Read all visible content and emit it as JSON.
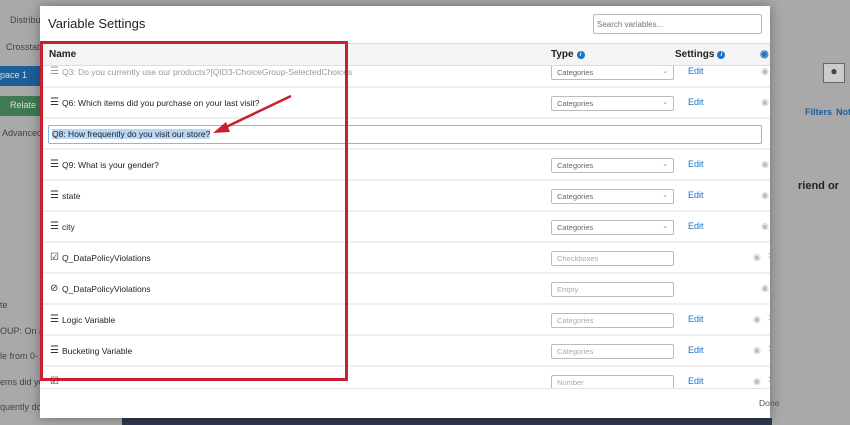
{
  "background": {
    "tab1": "Distribut",
    "tab2": "Crosstabs",
    "workspace": "pace 1",
    "relate": "Relate",
    "advanced": "Advanced",
    "filters": "Filters",
    "notes": "Note",
    "frag1": "te",
    "frag2": "OUP: On a",
    "frag3": "le from 0-",
    "frag4": "ems did yo",
    "frag5": "quently do",
    "frag6": "riend or"
  },
  "modal": {
    "title": "Variable Settings",
    "search_placeholder": "Search variables...",
    "columns": {
      "name": "Name",
      "type": "Type",
      "settings": "Settings"
    },
    "rows": [
      {
        "icon": "list-icon",
        "name": "Q3: Do you currently use our products?[QID3-ChoiceGroup-SelectedChoices",
        "type": "Categories",
        "edit": "Edit",
        "faded": true
      },
      {
        "icon": "list-icon",
        "name": "Q6: Which items did you purchase on your last visit?",
        "type": "Categories",
        "edit": "Edit"
      },
      {
        "editing": true,
        "name": "Q8: How frequently do you visit our store?"
      },
      {
        "icon": "list-icon",
        "name": "Q9: What is your gender?",
        "type": "Categories",
        "edit": "Edit"
      },
      {
        "icon": "list-icon",
        "name": "state",
        "type": "Categories",
        "edit": "Edit"
      },
      {
        "icon": "list-icon",
        "name": "city",
        "type": "Categories",
        "edit": "Edit"
      },
      {
        "icon": "checkbox-icon",
        "name": "Q_DataPolicyViolations",
        "type": "Checkboxes"
      },
      {
        "icon": "blocked-icon",
        "name": "Q_DataPolicyViolations",
        "type": "Empty"
      },
      {
        "icon": "list-icon",
        "name": "Logic Variable",
        "type": "Categories",
        "edit": "Edit"
      },
      {
        "icon": "list-icon",
        "name": "Bucketing Variable",
        "type": "Categories",
        "edit": "Edit"
      },
      {
        "icon": "checkbox-icon",
        "name": "",
        "type": "Number",
        "edit": "Edit"
      }
    ],
    "done": "Done"
  },
  "colors": {
    "accent": "#1a73c8",
    "highlight": "#c8202f"
  }
}
